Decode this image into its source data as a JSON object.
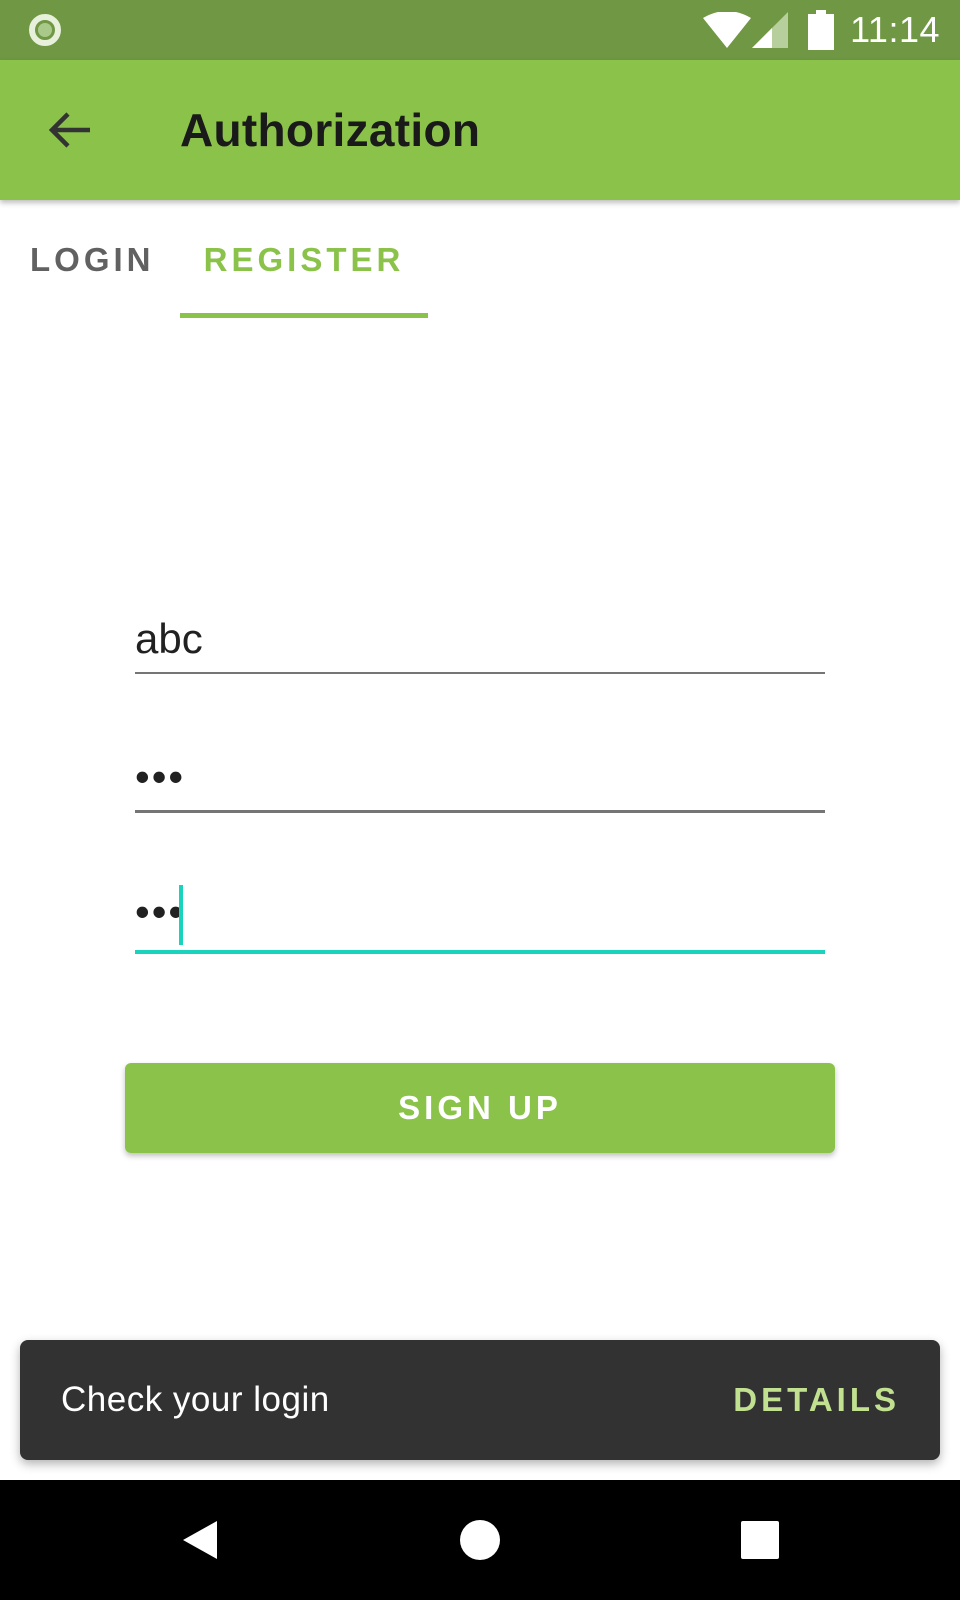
{
  "status_bar": {
    "time": "11:14",
    "icons": [
      "notification-circle-icon",
      "wifi-icon",
      "signal-icon",
      "battery-icon"
    ]
  },
  "app_bar": {
    "title": "Authorization",
    "back_icon": "arrow-back-icon"
  },
  "tabs": {
    "items": [
      {
        "label": "LOGIN",
        "selected": false
      },
      {
        "label": "REGISTER",
        "selected": true
      }
    ]
  },
  "form": {
    "username_value": "abc",
    "password_value": "•••",
    "confirm_password_value": "•••",
    "signup_label": "SIGN UP"
  },
  "snackbar": {
    "message": "Check your login",
    "action_label": "DETAILS"
  },
  "navigation_bar": {
    "icons": [
      "nav-back-icon",
      "nav-home-icon",
      "nav-recent-apps-icon"
    ]
  },
  "colors": {
    "status_bar": "#709744",
    "primary": "#8bc34a",
    "accent": "#1ad3bc",
    "snackbar_bg": "#323232",
    "snackbar_action": "#c1e190"
  }
}
